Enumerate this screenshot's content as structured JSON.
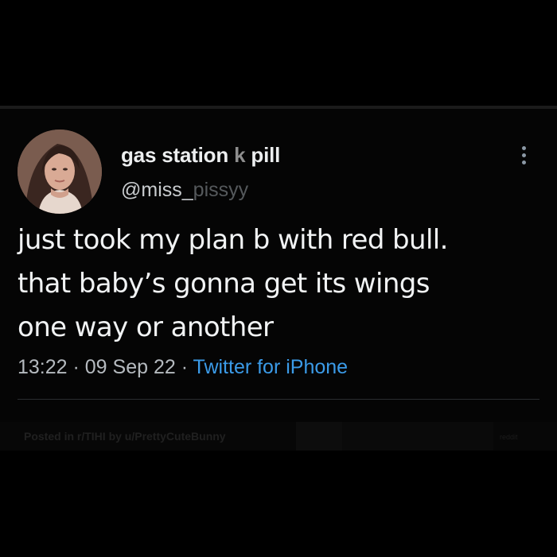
{
  "user": {
    "display_name_start": "gas station",
    "display_name_hidden": " ",
    "display_name_mid": "k",
    "display_name_end": " pill",
    "handle_visible": "@miss_",
    "handle_faded": "pissyy"
  },
  "tweet": {
    "lines": [
      "just took my plan b with red bull.",
      "that baby’s gonna get its wings",
      "one way or another"
    ]
  },
  "meta": {
    "time": "13:22",
    "separator": " · ",
    "date": "09 Sep 22",
    "source": "Twitter for iPhone"
  },
  "watermark": {
    "text": "Posted in r/TIHI by u/PrettyCuteBunny",
    "right_text": "reddit"
  },
  "icons": {
    "more": "more-vertical-icon",
    "avatar": "profile-photo"
  }
}
